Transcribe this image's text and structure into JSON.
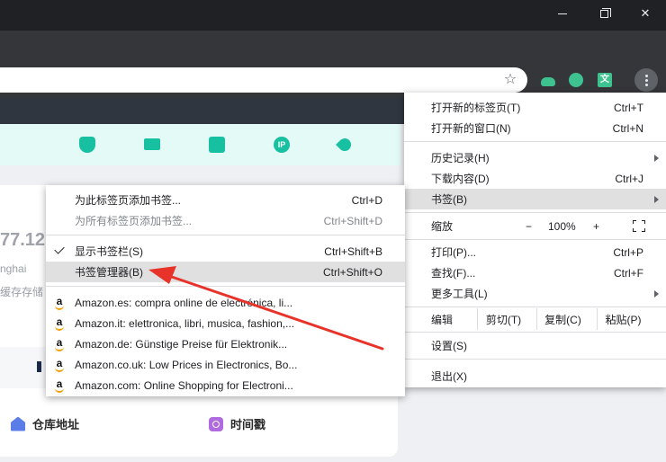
{
  "window": {
    "controls": [
      "minimize",
      "maximize",
      "close"
    ]
  },
  "extensions": [
    "cloud-upload-icon",
    "gear-extension-icon",
    "translate-icon"
  ],
  "page": {
    "ip_fragment": "77.12",
    "location_fragment": "nghai",
    "cache_fragment": "缓存存储",
    "toolbar_icons": [
      "shield-icon",
      "monitor-icon",
      "window-icon",
      "ip-icon",
      "rocket-icon"
    ],
    "warehouse_label": "仓库地址",
    "timestamp_label": "时间戳"
  },
  "main_menu": {
    "items": [
      {
        "label": "打开新的标签页(T)",
        "shortcut": "Ctrl+T"
      },
      {
        "label": "打开新的窗口(N)",
        "shortcut": "Ctrl+N"
      },
      {
        "label": "历史记录(H)",
        "shortcut": ""
      },
      {
        "label": "下载内容(D)",
        "shortcut": "Ctrl+J"
      },
      {
        "label": "书签(B)",
        "shortcut": ""
      },
      {
        "label": "缩放",
        "shortcut": ""
      },
      {
        "label": "打印(P)...",
        "shortcut": "Ctrl+P"
      },
      {
        "label": "查找(F)...",
        "shortcut": "Ctrl+F"
      },
      {
        "label": "更多工具(L)",
        "shortcut": ""
      },
      {
        "label": "设置(S)",
        "shortcut": ""
      },
      {
        "label": "退出(X)",
        "shortcut": ""
      }
    ],
    "zoom": {
      "minus": "−",
      "value": "100%",
      "plus": "+"
    },
    "edit": {
      "label": "编辑",
      "cut": "剪切(T)",
      "copy": "复制(C)",
      "paste": "粘贴(P)"
    }
  },
  "bookmarks_menu": {
    "items": [
      {
        "label": "为此标签页添加书签...",
        "shortcut": "Ctrl+D"
      },
      {
        "label": "为所有标签页添加书签...",
        "shortcut": "Ctrl+Shift+D"
      },
      {
        "label": "显示书签栏(S)",
        "shortcut": "Ctrl+Shift+B"
      },
      {
        "label": "书签管理器(B)",
        "shortcut": "Ctrl+Shift+O"
      }
    ],
    "bookmarks": [
      "Amazon.es: compra online de electrónica, li...",
      "Amazon.it: elettronica, libri, musica, fashion,...",
      "Amazon.de: Günstige Preise für Elektronik...",
      "Amazon.co.uk: Low Prices in Electronics, Bo...",
      "Amazon.com: Online Shopping for Electroni..."
    ]
  },
  "colors": {
    "titlebar": "#202124",
    "toolbar": "#35363a",
    "teal_accent": "#17c0a0",
    "highlight": "#e0e0e0",
    "arrow": "#e8332a"
  }
}
